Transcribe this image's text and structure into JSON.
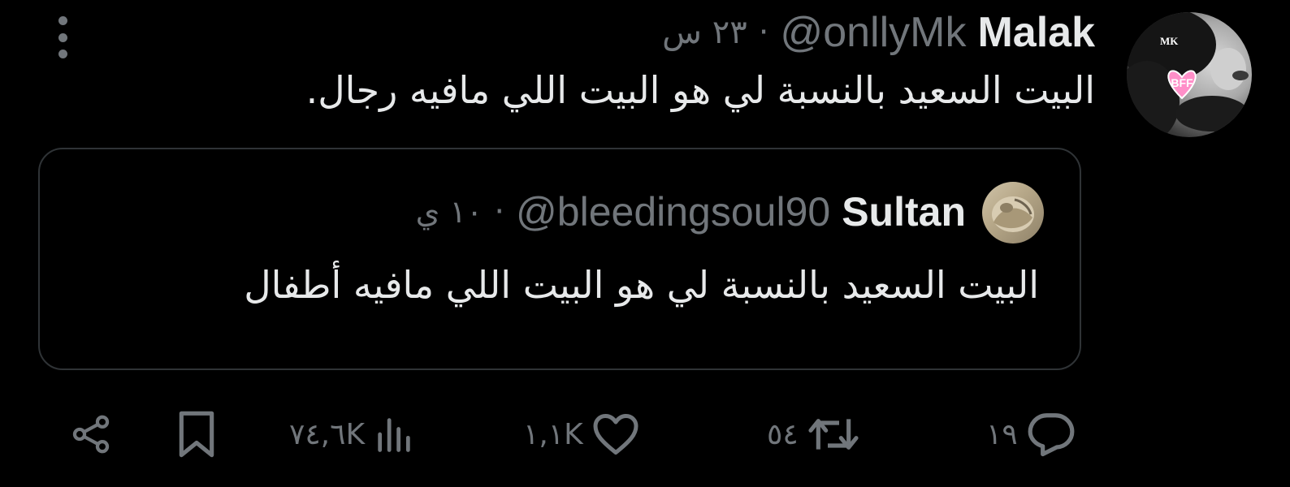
{
  "tweet": {
    "display_name": "Malak",
    "handle": "@onllyMk",
    "separator": "·",
    "time": "٢٣ س",
    "text": "البيت السعيد بالنسبة لي هو البيت اللي مافيه رجال.",
    "avatar": {
      "icon": "profile-photo-avatar",
      "badge_text": "BFF",
      "corner_text": "MK"
    }
  },
  "quoted_tweet": {
    "display_name": "Sultan",
    "handle": "@bleedingsoul90",
    "separator": "·",
    "time": "١٠ ي",
    "text": "البيت السعيد بالنسبة لي هو البيت اللي مافيه أطفال"
  },
  "actions": {
    "replies": {
      "icon": "reply-icon",
      "count": "١٩"
    },
    "retweets": {
      "icon": "retweet-icon",
      "count": "٥٤"
    },
    "likes": {
      "icon": "heart-icon",
      "count": "١,١K"
    },
    "views": {
      "icon": "views-chart-icon",
      "count": "٧٤,٦K"
    },
    "bookmark": {
      "icon": "bookmark-icon"
    },
    "share": {
      "icon": "share-icon"
    }
  },
  "colors": {
    "background": "#000000",
    "text_primary": "#e7e9ea",
    "text_secondary": "#71767b",
    "border": "#2f3336",
    "badge_pink": "#ff8fc8"
  }
}
